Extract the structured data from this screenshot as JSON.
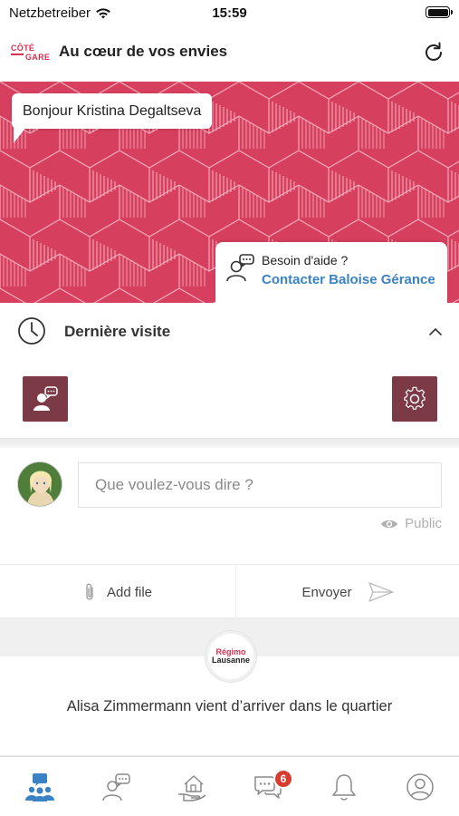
{
  "status_bar": {
    "carrier": "Netzbetreiber",
    "time": "15:59"
  },
  "header": {
    "logo_line1": "CÔTÉ",
    "logo_line2": "GARE",
    "title": "Au cœur de vos envies",
    "refresh_icon": "refresh-icon"
  },
  "banner": {
    "greeting": "Bonjour Kristina Degaltseva",
    "help_question": "Besoin d'aide ?",
    "help_link": "Contacter Baloise Gérance",
    "background_color": "#d63f5e"
  },
  "last_visit": {
    "title": "Dernière visite",
    "left_button_icon": "advisor-chat-icon",
    "right_button_icon": "gear-icon",
    "button_color": "#7b3a46"
  },
  "composer": {
    "placeholder": "Que voulez-vous dire ?",
    "visibility": "Public",
    "add_file_label": "Add file",
    "send_label": "Envoyer"
  },
  "feed": {
    "group_badge_line1": "Régimo",
    "group_badge_line2": "Lausanne",
    "message": "Alisa Zimmermann vient d’arriver dans le quartier"
  },
  "tab_bar": {
    "tabs": [
      {
        "icon": "community-icon",
        "active": true
      },
      {
        "icon": "advisor-chat-icon",
        "active": false
      },
      {
        "icon": "home-hand-icon",
        "active": false
      },
      {
        "icon": "messages-icon",
        "active": false,
        "badge": "6"
      },
      {
        "icon": "bell-icon",
        "active": false
      },
      {
        "icon": "profile-icon",
        "active": false
      }
    ],
    "active_color": "#3a82c4",
    "inactive_color": "#8a8a8a"
  }
}
